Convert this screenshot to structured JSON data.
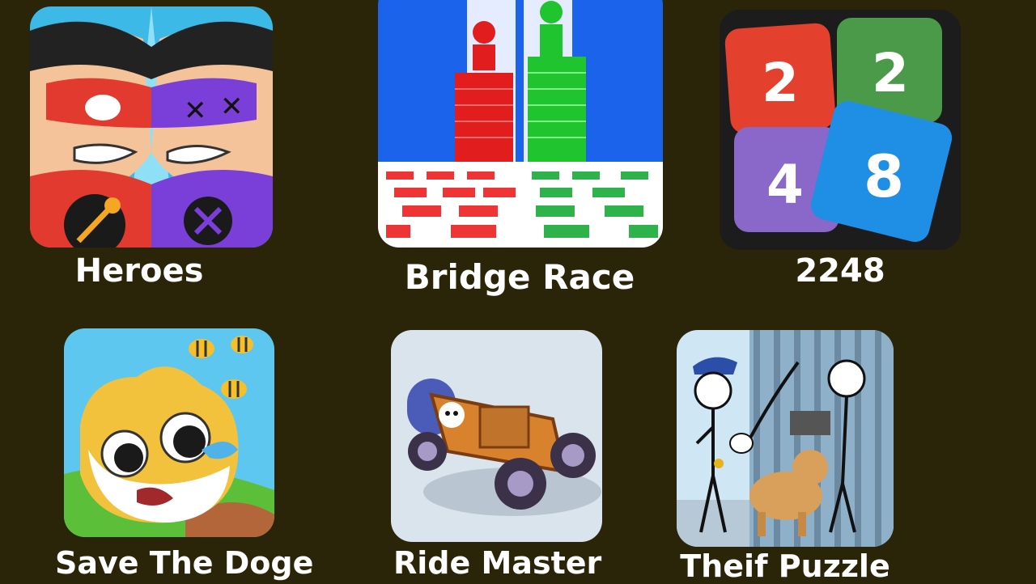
{
  "games": [
    {
      "id": "heroes",
      "title": "Heroes",
      "icon": "heroes-face-off-icon"
    },
    {
      "id": "bridge-race",
      "title": "Bridge Race",
      "icon": "stair-race-icon"
    },
    {
      "id": "2248",
      "title": "2248",
      "icon": "number-tiles-icon",
      "tiles": [
        "2",
        "2",
        "4",
        "8"
      ]
    },
    {
      "id": "save-the-doge",
      "title": "Save The Doge",
      "icon": "crying-doge-bees-icon"
    },
    {
      "id": "ride-master",
      "title": "Ride Master",
      "icon": "buggy-car-icon"
    },
    {
      "id": "theif-puzzle",
      "title": "Theif Puzzle",
      "icon": "stickman-jail-icon"
    }
  ]
}
